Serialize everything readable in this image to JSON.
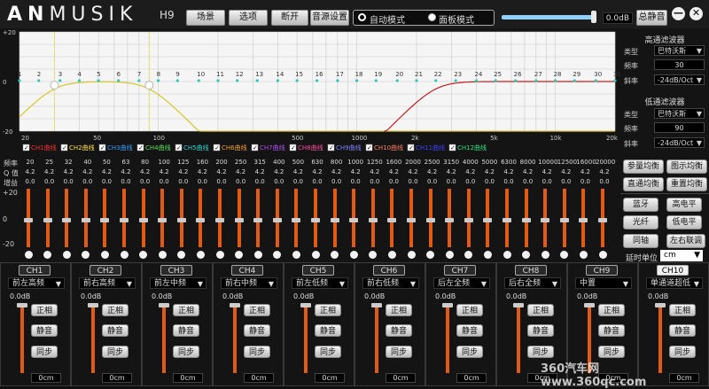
{
  "header": {
    "logo_bold": "AN",
    "logo_rest": "MUSIK",
    "model": "H9",
    "buttons": [
      "场景",
      "选项",
      "断开",
      "音源设置"
    ],
    "modes": [
      "自动模式",
      "面板模式"
    ],
    "active_mode": 0,
    "volume_fraction": 0.98,
    "volume_db": "0.0dB",
    "mute_all": "总静音",
    "minimize": "—",
    "close": "✕"
  },
  "eq_graph": {
    "y_labels": [
      "+20",
      "0",
      "-20"
    ],
    "x_labels": [
      "20",
      "50",
      "100",
      "500",
      "1000",
      "2k",
      "5k",
      "10k",
      "20k"
    ],
    "band_numbers": [
      "1",
      "2",
      "3",
      "4",
      "5",
      "6",
      "7",
      "8",
      "9",
      "10",
      "11",
      "12",
      "13",
      "14",
      "15",
      "16",
      "17",
      "18",
      "19",
      "20",
      "21",
      "22",
      "23",
      "24",
      "25",
      "26",
      "27",
      "28",
      "29",
      "30",
      "31"
    ],
    "channel_legend": [
      {
        "label": "CH1曲线",
        "color": "#ff3030"
      },
      {
        "label": "CH2曲线",
        "color": "#ffe24a"
      },
      {
        "label": "CH3曲线",
        "color": "#3aa0ff"
      },
      {
        "label": "CH4曲线",
        "color": "#58e05a"
      },
      {
        "label": "CH5曲线",
        "color": "#2fd6d6"
      },
      {
        "label": "CH6曲线",
        "color": "#f0a030"
      },
      {
        "label": "CH7曲线",
        "color": "#b050f0"
      },
      {
        "label": "CH8曲线",
        "color": "#ff50a0"
      },
      {
        "label": "CH9曲线",
        "color": "#8080ff"
      },
      {
        "label": "CH10曲线",
        "color": "#ff8060"
      },
      {
        "label": "CH11曲线",
        "color": "#4040ff"
      },
      {
        "label": "CH12曲线",
        "color": "#30e080"
      }
    ],
    "curve_colors": {
      "highpass": "#d9c83a",
      "lowpass": "#c02020",
      "dots": "#2ec9b0"
    }
  },
  "high_pass": {
    "title": "高通滤波器",
    "type_label": "类型",
    "type_value": "巴特沃斯",
    "freq_label": "频率",
    "freq_value": "30",
    "slope_label": "斜率",
    "slope_value": "-24dB/Oct"
  },
  "low_pass": {
    "title": "低通滤波器",
    "type_label": "类型",
    "type_value": "巴特沃斯",
    "freq_label": "频率",
    "freq_value": "90",
    "slope_label": "斜率",
    "slope_value": "-24dB/Oct"
  },
  "params": {
    "freq_label": "频率",
    "q_label": "Q 值",
    "gain_label": "增益",
    "frequencies": [
      "20",
      "25",
      "32",
      "40",
      "50",
      "63",
      "80",
      "100",
      "125",
      "160",
      "200",
      "250",
      "315",
      "400",
      "500",
      "630",
      "800",
      "1000",
      "1250",
      "1600",
      "2000",
      "2500",
      "3150",
      "4000",
      "5000",
      "6300",
      "8000",
      "10000",
      "12500",
      "16000",
      "20000"
    ],
    "q_value": "4.2",
    "gain_value": "0.0"
  },
  "faders": {
    "scale": [
      "+20",
      "0",
      "-20"
    ],
    "levels": [
      0.5,
      0.5,
      0.5,
      0.5,
      0.5,
      0.5,
      0.5,
      0.5,
      0.5,
      0.5,
      0.5,
      0.5,
      0.5,
      0.5,
      0.5,
      0.5,
      0.5,
      0.5,
      0.5,
      0.5,
      0.5,
      0.5,
      0.5,
      0.5,
      0.5,
      0.5,
      0.5,
      0.5,
      0.5,
      0.5,
      0.5
    ]
  },
  "controls": {
    "param_eq": "参量均衡",
    "graphic_eq": "图示均衡",
    "straight_eq": "直通均衡",
    "reset_eq": "重置均衡",
    "bluetooth": "蓝牙",
    "high_level": "高电平",
    "optical": "光纤",
    "low_level": "低电平",
    "coax": "同轴",
    "lr_link": "左右联调",
    "delay_unit_label": "延时单位",
    "delay_unit_value": "cm"
  },
  "channels": [
    {
      "tab": "CH1",
      "source": "前左高频",
      "db": "0.0dB",
      "phase": "正相",
      "mute": "静音",
      "sync": "同步",
      "delay": "0cm"
    },
    {
      "tab": "CH2",
      "source": "前右高频",
      "db": "0.0dB",
      "phase": "正相",
      "mute": "静音",
      "sync": "同步",
      "delay": "0cm"
    },
    {
      "tab": "CH3",
      "source": "前左中频",
      "db": "0.0dB",
      "phase": "正相",
      "mute": "静音",
      "sync": "同步",
      "delay": "0cm"
    },
    {
      "tab": "CH4",
      "source": "前右中频",
      "db": "0.0dB",
      "phase": "正相",
      "mute": "静音",
      "sync": "同步",
      "delay": "0cm"
    },
    {
      "tab": "CH5",
      "source": "前左低频",
      "db": "0.0dB",
      "phase": "正相",
      "mute": "静音",
      "sync": "同步",
      "delay": "0cm"
    },
    {
      "tab": "CH6",
      "source": "前右低频",
      "db": "0.0dB",
      "phase": "正相",
      "mute": "静音",
      "sync": "同步",
      "delay": "0cm"
    },
    {
      "tab": "CH7",
      "source": "后左全频",
      "db": "0.0dB",
      "phase": "正相",
      "mute": "静音",
      "sync": "同步",
      "delay": "0cm"
    },
    {
      "tab": "CH8",
      "source": "后右全频",
      "db": "0.0dB",
      "phase": "正相",
      "mute": "静音",
      "sync": "同步",
      "delay": "0cm"
    },
    {
      "tab": "CH9",
      "source": "中置",
      "db": "0.0dB",
      "phase": "正相",
      "mute": "静音",
      "sync": "同步",
      "delay": "0cm"
    },
    {
      "tab": "CH10",
      "source": "单通道超低",
      "db": "0.0dB",
      "phase": "正相",
      "mute": "静音",
      "sync": "同步",
      "delay": "0cm",
      "active": true
    }
  ],
  "watermark": "360汽车网 www.360qc.com"
}
